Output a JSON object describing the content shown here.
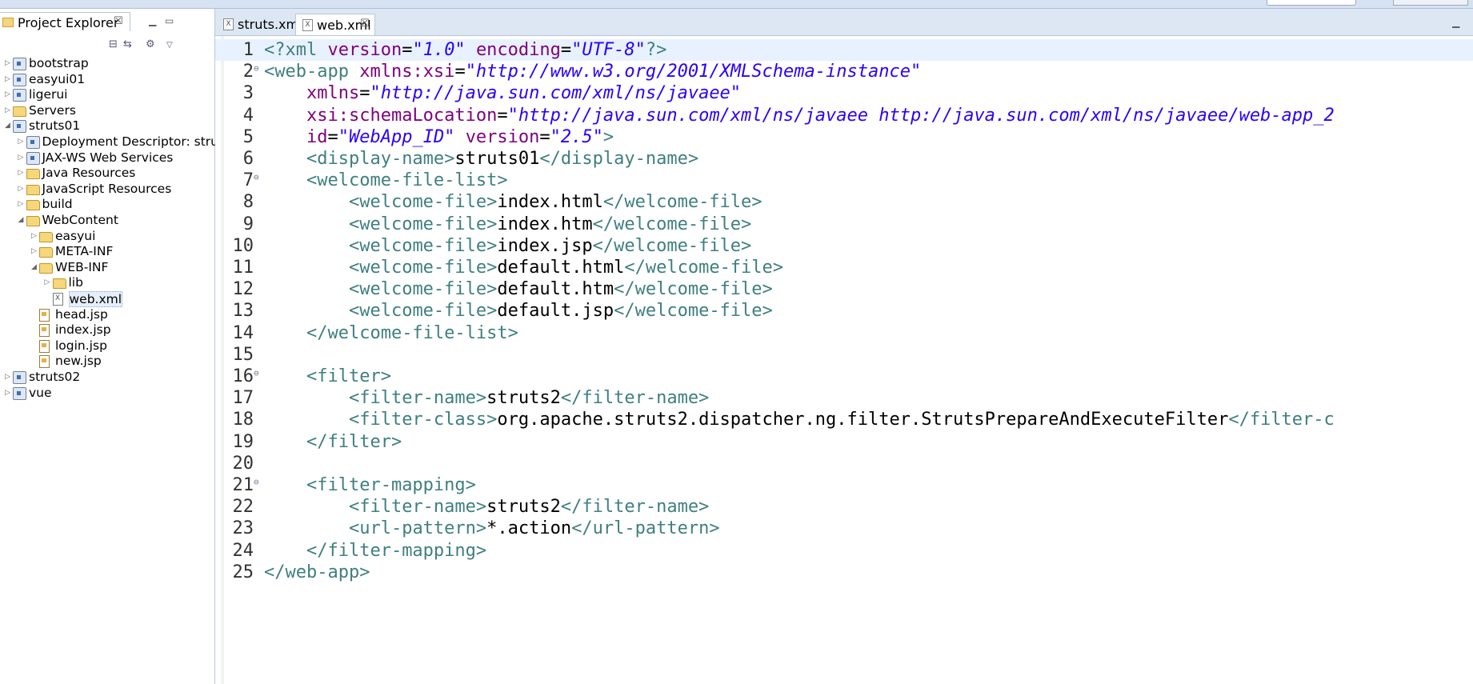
{
  "explorer": {
    "title": "Project Explorer",
    "tree": [
      {
        "label": "bootstrap",
        "depth": 0,
        "icon": "project-icon",
        "expanded": false
      },
      {
        "label": "easyui01",
        "depth": 0,
        "icon": "project-icon",
        "expanded": false
      },
      {
        "label": "ligerui",
        "depth": 0,
        "icon": "project-icon",
        "expanded": false
      },
      {
        "label": "Servers",
        "depth": 0,
        "icon": "folder-icon",
        "expanded": false
      },
      {
        "label": "struts01",
        "depth": 0,
        "icon": "project-icon",
        "expanded": true
      },
      {
        "label": "Deployment Descriptor: stru",
        "depth": 1,
        "icon": "descriptor-icon",
        "expanded": false
      },
      {
        "label": "JAX-WS Web Services",
        "depth": 1,
        "icon": "webservice-icon",
        "expanded": false
      },
      {
        "label": "Java Resources",
        "depth": 1,
        "icon": "java-resources-icon",
        "expanded": false
      },
      {
        "label": "JavaScript Resources",
        "depth": 1,
        "icon": "js-resources-icon",
        "expanded": false
      },
      {
        "label": "build",
        "depth": 1,
        "icon": "folder-icon",
        "expanded": false
      },
      {
        "label": "WebContent",
        "depth": 1,
        "icon": "folder-icon",
        "expanded": true
      },
      {
        "label": "easyui",
        "depth": 2,
        "icon": "folder-icon",
        "expanded": false
      },
      {
        "label": "META-INF",
        "depth": 2,
        "icon": "folder-icon",
        "expanded": false
      },
      {
        "label": "WEB-INF",
        "depth": 2,
        "icon": "folder-icon",
        "expanded": true
      },
      {
        "label": "lib",
        "depth": 3,
        "icon": "folder-icon",
        "expanded": false
      },
      {
        "label": "web.xml",
        "depth": 3,
        "icon": "xml-file-icon",
        "leaf": true,
        "selected": true
      },
      {
        "label": "head.jsp",
        "depth": 2,
        "icon": "jsp-file-icon",
        "leaf": true
      },
      {
        "label": "index.jsp",
        "depth": 2,
        "icon": "jsp-file-icon",
        "leaf": true
      },
      {
        "label": "login.jsp",
        "depth": 2,
        "icon": "jsp-file-icon",
        "leaf": true
      },
      {
        "label": "new.jsp",
        "depth": 2,
        "icon": "jsp-file-icon",
        "leaf": true
      },
      {
        "label": "struts02",
        "depth": 0,
        "icon": "project-icon",
        "expanded": false
      },
      {
        "label": "vue",
        "depth": 0,
        "icon": "project-icon",
        "expanded": false
      }
    ]
  },
  "editor": {
    "tabs": [
      {
        "label": "struts.xml",
        "active": false
      },
      {
        "label": "web.xml",
        "active": true
      }
    ],
    "highlighted_line": 1,
    "lines": [
      {
        "n": "1",
        "fold": false,
        "tokens": [
          [
            "pi",
            "<?xml "
          ],
          [
            "attr",
            "version"
          ],
          [
            "txt",
            "="
          ],
          [
            "str",
            "\"1.0\""
          ],
          [
            "txt",
            " "
          ],
          [
            "attr",
            "encoding"
          ],
          [
            "txt",
            "="
          ],
          [
            "str",
            "\"UTF-8\""
          ],
          [
            "pi",
            "?>"
          ]
        ]
      },
      {
        "n": "2",
        "fold": true,
        "tokens": [
          [
            "tag",
            "<web-app "
          ],
          [
            "attr",
            "xmlns:xsi"
          ],
          [
            "txt",
            "="
          ],
          [
            "str",
            "\"http://www.w3.org/2001/XMLSchema-instance\""
          ]
        ]
      },
      {
        "n": "3",
        "fold": false,
        "tokens": [
          [
            "txt",
            "    "
          ],
          [
            "attr",
            "xmlns"
          ],
          [
            "txt",
            "="
          ],
          [
            "str",
            "\"http://java.sun.com/xml/ns/javaee\""
          ]
        ]
      },
      {
        "n": "4",
        "fold": false,
        "tokens": [
          [
            "txt",
            "    "
          ],
          [
            "attr",
            "xsi:schemaLocation"
          ],
          [
            "txt",
            "="
          ],
          [
            "str",
            "\"http://java.sun.com/xml/ns/javaee http://java.sun.com/xml/ns/javaee/web-app_2"
          ]
        ]
      },
      {
        "n": "5",
        "fold": false,
        "tokens": [
          [
            "txt",
            "    "
          ],
          [
            "attr",
            "id"
          ],
          [
            "txt",
            "="
          ],
          [
            "str",
            "\"WebApp_ID\""
          ],
          [
            "txt",
            " "
          ],
          [
            "attr",
            "version"
          ],
          [
            "txt",
            "="
          ],
          [
            "str",
            "\"2.5\""
          ],
          [
            "tag",
            ">"
          ]
        ]
      },
      {
        "n": "6",
        "fold": false,
        "tokens": [
          [
            "txt",
            "    "
          ],
          [
            "tag",
            "<display-name>"
          ],
          [
            "txt",
            "struts01"
          ],
          [
            "tag",
            "</display-name>"
          ]
        ]
      },
      {
        "n": "7",
        "fold": true,
        "tokens": [
          [
            "txt",
            "    "
          ],
          [
            "tag",
            "<welcome-file-list>"
          ]
        ]
      },
      {
        "n": "8",
        "fold": false,
        "tokens": [
          [
            "txt",
            "        "
          ],
          [
            "tag",
            "<welcome-file>"
          ],
          [
            "txt",
            "index.html"
          ],
          [
            "tag",
            "</welcome-file>"
          ]
        ]
      },
      {
        "n": "9",
        "fold": false,
        "tokens": [
          [
            "txt",
            "        "
          ],
          [
            "tag",
            "<welcome-file>"
          ],
          [
            "txt",
            "index.htm"
          ],
          [
            "tag",
            "</welcome-file>"
          ]
        ]
      },
      {
        "n": "10",
        "fold": false,
        "tokens": [
          [
            "txt",
            "        "
          ],
          [
            "tag",
            "<welcome-file>"
          ],
          [
            "txt",
            "index.jsp"
          ],
          [
            "tag",
            "</welcome-file>"
          ]
        ]
      },
      {
        "n": "11",
        "fold": false,
        "tokens": [
          [
            "txt",
            "        "
          ],
          [
            "tag",
            "<welcome-file>"
          ],
          [
            "txt",
            "default.html"
          ],
          [
            "tag",
            "</welcome-file>"
          ]
        ]
      },
      {
        "n": "12",
        "fold": false,
        "tokens": [
          [
            "txt",
            "        "
          ],
          [
            "tag",
            "<welcome-file>"
          ],
          [
            "txt",
            "default.htm"
          ],
          [
            "tag",
            "</welcome-file>"
          ]
        ]
      },
      {
        "n": "13",
        "fold": false,
        "tokens": [
          [
            "txt",
            "        "
          ],
          [
            "tag",
            "<welcome-file>"
          ],
          [
            "txt",
            "default.jsp"
          ],
          [
            "tag",
            "</welcome-file>"
          ]
        ]
      },
      {
        "n": "14",
        "fold": false,
        "tokens": [
          [
            "txt",
            "    "
          ],
          [
            "tag",
            "</welcome-file-list>"
          ]
        ]
      },
      {
        "n": "15",
        "fold": false,
        "tokens": []
      },
      {
        "n": "16",
        "fold": true,
        "tokens": [
          [
            "txt",
            "    "
          ],
          [
            "tag",
            "<filter>"
          ]
        ]
      },
      {
        "n": "17",
        "fold": false,
        "tokens": [
          [
            "txt",
            "        "
          ],
          [
            "tag",
            "<filter-name>"
          ],
          [
            "txt",
            "struts2"
          ],
          [
            "tag",
            "</filter-name>"
          ]
        ]
      },
      {
        "n": "18",
        "fold": false,
        "tokens": [
          [
            "txt",
            "        "
          ],
          [
            "tag",
            "<filter-class>"
          ],
          [
            "txt",
            "org.apache.struts2.dispatcher.ng.filter.StrutsPrepareAndExecuteFilter"
          ],
          [
            "tag",
            "</filter-c"
          ]
        ]
      },
      {
        "n": "19",
        "fold": false,
        "tokens": [
          [
            "txt",
            "    "
          ],
          [
            "tag",
            "</filter>"
          ]
        ]
      },
      {
        "n": "20",
        "fold": false,
        "tokens": []
      },
      {
        "n": "21",
        "fold": true,
        "tokens": [
          [
            "txt",
            "    "
          ],
          [
            "tag",
            "<filter-mapping>"
          ]
        ]
      },
      {
        "n": "22",
        "fold": false,
        "tokens": [
          [
            "txt",
            "        "
          ],
          [
            "tag",
            "<filter-name>"
          ],
          [
            "txt",
            "struts2"
          ],
          [
            "tag",
            "</filter-name>"
          ]
        ]
      },
      {
        "n": "23",
        "fold": false,
        "tokens": [
          [
            "txt",
            "        "
          ],
          [
            "tag",
            "<url-pattern>"
          ],
          [
            "txt",
            "*.action"
          ],
          [
            "tag",
            "</url-pattern>"
          ]
        ]
      },
      {
        "n": "24",
        "fold": false,
        "tokens": [
          [
            "txt",
            "    "
          ],
          [
            "tag",
            "</filter-mapping>"
          ]
        ]
      },
      {
        "n": "25",
        "fold": false,
        "tokens": [
          [
            "tag",
            "</web-app>"
          ]
        ]
      }
    ]
  }
}
